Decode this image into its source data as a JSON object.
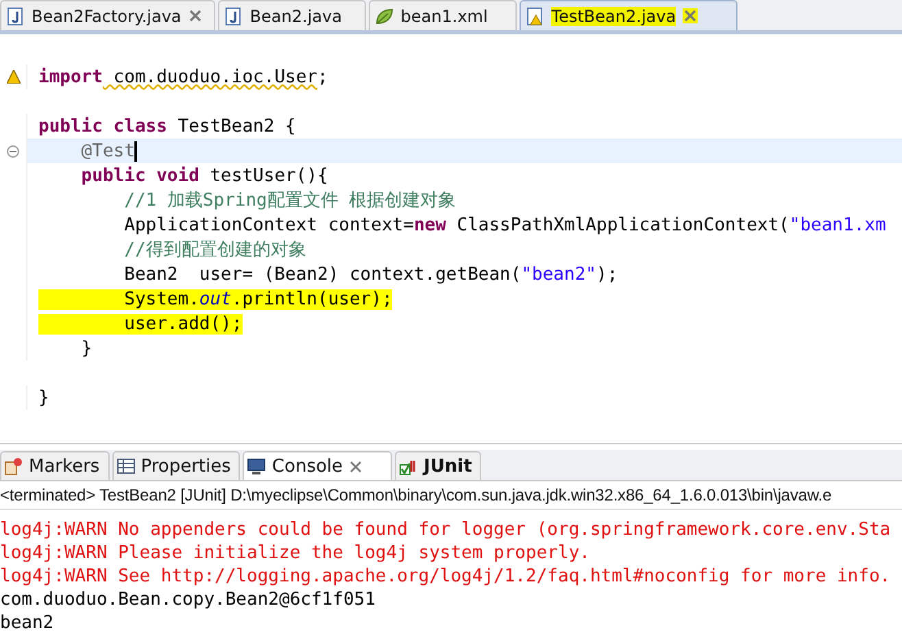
{
  "editor_tabs": [
    {
      "label": "Bean2Factory.java",
      "kind": "java",
      "selected": false,
      "closable": true,
      "highlighted": false
    },
    {
      "label": "Bean2.java",
      "kind": "java",
      "selected": false,
      "closable": false,
      "highlighted": false
    },
    {
      "label": "bean1.xml",
      "kind": "xml",
      "selected": false,
      "closable": false,
      "highlighted": false
    },
    {
      "label": "TestBean2.java",
      "kind": "java-warning",
      "selected": true,
      "closable": true,
      "highlighted": true
    }
  ],
  "code_lines": [
    {
      "spaced": false,
      "warning": true,
      "collapsible": false,
      "current": false,
      "highlighted": false,
      "segments": [
        {
          "kind": "keyword",
          "text": "import"
        },
        {
          "kind": "squiggly",
          "text": " com.duoduo.ioc.User"
        },
        {
          "kind": "plain",
          "text": ";"
        }
      ]
    },
    {
      "spaced": true,
      "warning": false,
      "collapsible": false,
      "current": false,
      "highlighted": false,
      "segments": [
        {
          "kind": "keyword",
          "text": "public class"
        },
        {
          "kind": "plain",
          "text": " TestBean2 {"
        }
      ]
    },
    {
      "spaced": false,
      "warning": false,
      "collapsible": true,
      "current": true,
      "highlighted": false,
      "segments": [
        {
          "kind": "annotation",
          "text": "    @Test"
        }
      ]
    },
    {
      "spaced": false,
      "warning": false,
      "collapsible": false,
      "current": false,
      "highlighted": false,
      "segments": [
        {
          "kind": "keyword",
          "text": "    public void"
        },
        {
          "kind": "plain",
          "text": " testUser(){"
        }
      ]
    },
    {
      "spaced": false,
      "warning": false,
      "collapsible": false,
      "current": false,
      "highlighted": false,
      "segments": [
        {
          "kind": "comment",
          "text": "        //1 加载Spring配置文件 根据创建对象"
        }
      ]
    },
    {
      "spaced": false,
      "warning": false,
      "collapsible": false,
      "current": false,
      "highlighted": false,
      "segments": [
        {
          "kind": "plain",
          "text": "        ApplicationContext context="
        },
        {
          "kind": "keyword",
          "text": "new"
        },
        {
          "kind": "plain",
          "text": " ClassPathXmlApplicationContext("
        },
        {
          "kind": "string",
          "text": "\"bean1.xm"
        }
      ]
    },
    {
      "spaced": false,
      "warning": false,
      "collapsible": false,
      "current": false,
      "highlighted": false,
      "segments": [
        {
          "kind": "comment",
          "text": "        //得到配置创建的对象"
        }
      ]
    },
    {
      "spaced": false,
      "warning": false,
      "collapsible": false,
      "current": false,
      "highlighted": false,
      "segments": [
        {
          "kind": "plain",
          "text": "        Bean2  user= (Bean2) context.getBean("
        },
        {
          "kind": "string",
          "text": "\"bean2\""
        },
        {
          "kind": "plain",
          "text": ");"
        }
      ]
    },
    {
      "spaced": false,
      "warning": false,
      "collapsible": false,
      "current": false,
      "highlighted": true,
      "segments": [
        {
          "kind": "plain",
          "text": "        System."
        },
        {
          "kind": "static",
          "text": "out"
        },
        {
          "kind": "plain",
          "text": ".println(user);"
        }
      ]
    },
    {
      "spaced": false,
      "warning": false,
      "collapsible": false,
      "current": false,
      "highlighted": true,
      "segments": [
        {
          "kind": "plain",
          "text": "        user.add();"
        }
      ]
    },
    {
      "spaced": false,
      "warning": false,
      "collapsible": false,
      "current": false,
      "highlighted": false,
      "segments": [
        {
          "kind": "plain",
          "text": "    }"
        }
      ]
    },
    {
      "spaced": true,
      "warning": false,
      "collapsible": false,
      "current": false,
      "highlighted": false,
      "segments": [
        {
          "kind": "plain",
          "text": "}"
        }
      ]
    }
  ],
  "panel_tabs": [
    {
      "label": "Markers",
      "kind": "markers",
      "selected": false,
      "closable": false,
      "bold": false
    },
    {
      "label": "Properties",
      "kind": "properties",
      "selected": false,
      "closable": false,
      "bold": false
    },
    {
      "label": "Console",
      "kind": "console",
      "selected": true,
      "closable": true,
      "bold": false
    },
    {
      "label": "JUnit",
      "kind": "junit",
      "selected": false,
      "closable": false,
      "bold": true
    }
  ],
  "console": {
    "header": "<terminated> TestBean2 [JUnit] D:\\myeclipse\\Common\\binary\\com.sun.java.jdk.win32.x86_64_1.6.0.013\\bin\\javaw.e",
    "lines": [
      {
        "kind": "error",
        "text": "log4j:WARN No appenders could be found for logger (org.springframework.core.env.Sta"
      },
      {
        "kind": "error",
        "text": "log4j:WARN Please initialize the log4j system properly."
      },
      {
        "kind": "error",
        "text": "log4j:WARN See http://logging.apache.org/log4j/1.2/faq.html#noconfig for more info."
      },
      {
        "kind": "output",
        "text": "com.duoduo.Bean.copy.Bean2@6cf1f051"
      },
      {
        "kind": "output",
        "text": "bean2"
      }
    ]
  }
}
